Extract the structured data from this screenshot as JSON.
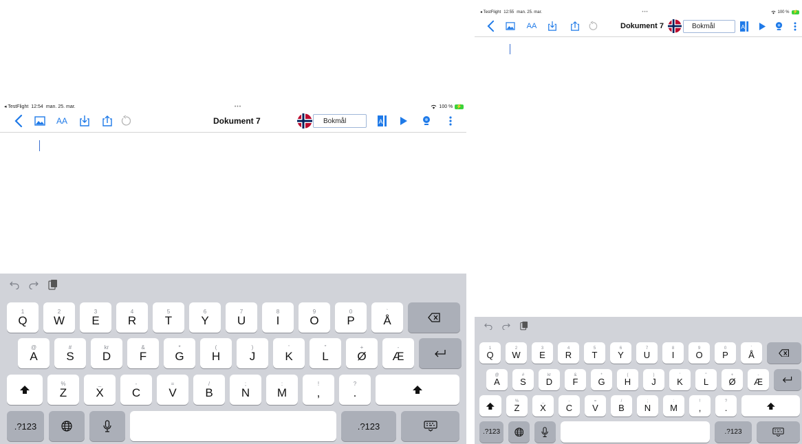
{
  "status": {
    "app": "◂ TestFlight",
    "time_left": "12:54",
    "time_right": "12:55",
    "date": "man. 25. mar.",
    "dots": "•••",
    "wifi": "wifi-icon",
    "battery": "100 %"
  },
  "toolbar": {
    "title": "Dokument 7",
    "language": "Bokmål",
    "icons": [
      "back-chevron-icon",
      "image-icon",
      "text-size-icon",
      "import-icon",
      "share-icon",
      "undo-icon",
      "flag-norway-icon",
      "read-icon",
      "play-icon",
      "speaker-icon",
      "more-icon"
    ],
    "text_size_label": "AA"
  },
  "keyboard": {
    "row1": [
      [
        "1",
        "Q"
      ],
      [
        "2",
        "W"
      ],
      [
        "3",
        "E"
      ],
      [
        "4",
        "R"
      ],
      [
        "5",
        "T"
      ],
      [
        "6",
        "Y"
      ],
      [
        "7",
        "U"
      ],
      [
        "8",
        "I"
      ],
      [
        "9",
        "O"
      ],
      [
        "0",
        "P"
      ],
      [
        "`",
        "Å"
      ]
    ],
    "row2": [
      [
        "@",
        "A"
      ],
      [
        "#",
        "S"
      ],
      [
        "kr",
        "D"
      ],
      [
        "&",
        "F"
      ],
      [
        "*",
        "G"
      ],
      [
        "(",
        "H"
      ],
      [
        ")",
        "J"
      ],
      [
        "'",
        "K"
      ],
      [
        "\"",
        "L"
      ],
      [
        "+",
        "Ø"
      ],
      [
        "-",
        "Æ"
      ]
    ],
    "row3": [
      [
        "%",
        "Z"
      ],
      [
        "_",
        "X"
      ],
      [
        "-",
        "C"
      ],
      [
        "=",
        "V"
      ],
      [
        "/",
        "B"
      ],
      [
        ";",
        "N"
      ],
      [
        ":",
        "M"
      ],
      [
        "!",
        ","
      ],
      [
        "?",
        "."
      ]
    ],
    "numbers_label": ".?123",
    "delete_icon": "delete-icon",
    "return_icon": "return-icon",
    "shift_icon": "shift-icon",
    "globe_icon": "globe-icon",
    "mic_icon": "microphone-icon",
    "hide_icon": "keyboard-hide-icon",
    "suggestion_icons": [
      "undo-arrow-icon",
      "redo-arrow-icon",
      "paste-icon"
    ]
  },
  "colors": {
    "accent": "#1f7ae8",
    "keyboard_bg": "#d1d3d9",
    "key_dark": "#abafb8",
    "flag_red": "#ba0c2f",
    "flag_blue": "#00205b"
  }
}
